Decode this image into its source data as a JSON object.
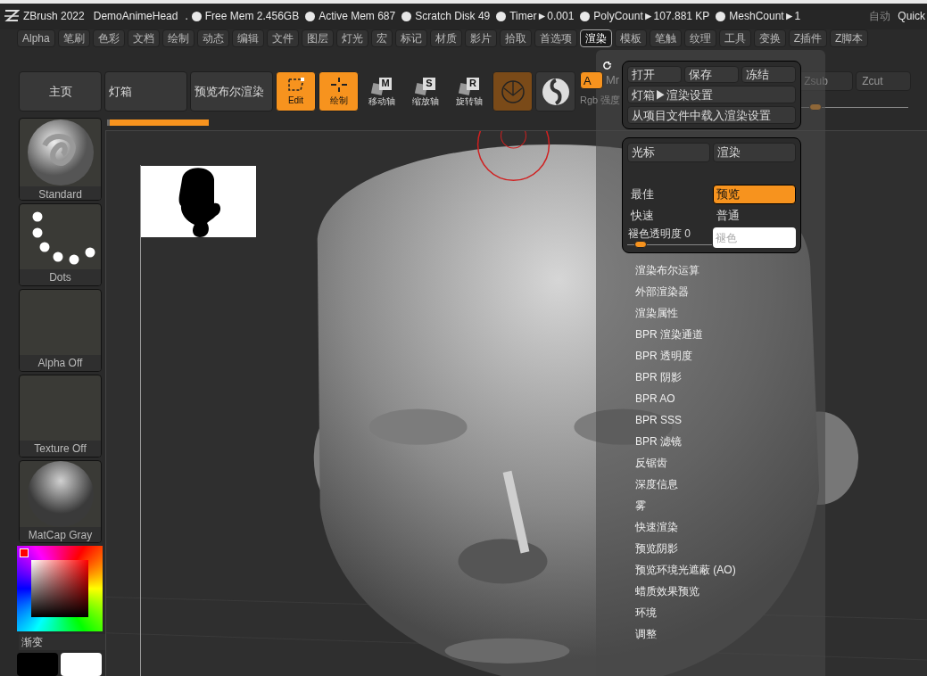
{
  "title_bar": {
    "app": "ZBrush 2022",
    "document": "DemoAnimeHead",
    "separator": ".",
    "stats": [
      "Free Mem 2.456GB",
      "Active Mem 687",
      "Scratch Disk 49",
      "Timer►0.001",
      "PolyCount►107.881 KP",
      "MeshCount►1"
    ],
    "right": [
      "自动",
      "Quick"
    ]
  },
  "menu": [
    {
      "label": "Alpha",
      "selected": false
    },
    {
      "label": "笔刷",
      "selected": false
    },
    {
      "label": "色彩",
      "selected": false
    },
    {
      "label": "文档",
      "selected": false
    },
    {
      "label": "绘制",
      "selected": false
    },
    {
      "label": "动态",
      "selected": false
    },
    {
      "label": "编辑",
      "selected": false
    },
    {
      "label": "文件",
      "selected": false
    },
    {
      "label": "图层",
      "selected": false
    },
    {
      "label": "灯光",
      "selected": false
    },
    {
      "label": "宏",
      "selected": false
    },
    {
      "label": "标记",
      "selected": false
    },
    {
      "label": "材质",
      "selected": false
    },
    {
      "label": "影片",
      "selected": false
    },
    {
      "label": "拾取",
      "selected": false
    },
    {
      "label": "首选项",
      "selected": false
    },
    {
      "label": "渲染",
      "selected": true
    },
    {
      "label": "模板",
      "selected": false
    },
    {
      "label": "笔触",
      "selected": false
    },
    {
      "label": "纹理",
      "selected": false
    },
    {
      "label": "工具",
      "selected": false
    },
    {
      "label": "变换",
      "selected": false
    },
    {
      "label": "Z插件",
      "selected": false
    },
    {
      "label": "Z脚本",
      "selected": false
    }
  ],
  "toolbar": [
    {
      "kind": "text",
      "label": "主页",
      "centered": true
    },
    {
      "kind": "text",
      "label": "灯箱",
      "centered": false
    },
    {
      "kind": "text",
      "label": "预览布尔渲染",
      "centered": false
    },
    {
      "kind": "tool",
      "label": "Edit",
      "active": true
    },
    {
      "kind": "tool",
      "label": "绘制",
      "active": true
    },
    {
      "kind": "axis",
      "letter": "M",
      "label": "移动轴"
    },
    {
      "kind": "axis",
      "letter": "S",
      "label": "缩放轴"
    },
    {
      "kind": "axis",
      "letter": "R",
      "label": "旋转轴"
    },
    {
      "kind": "material"
    },
    {
      "kind": "sphere"
    }
  ],
  "channel": {
    "label": "A",
    "active": true,
    "next": "Mr",
    "caption": "Rgb 强度"
  },
  "z_controls": [
    {
      "label": "Zsub",
      "active": false
    },
    {
      "label": "Zcut",
      "active": false
    }
  ],
  "z_slider": {
    "level": 0.12
  },
  "progress": {
    "level": 0.97
  },
  "left_tiles": [
    {
      "kind": "brush",
      "label": "Standard"
    },
    {
      "kind": "dots",
      "label": "Dots"
    },
    {
      "kind": "empty",
      "label": "Alpha Off"
    },
    {
      "kind": "empty",
      "label": "Texture Off"
    },
    {
      "kind": "matcap",
      "label": "MatCap Gray"
    }
  ],
  "color_picker": {
    "color": "#ff0000"
  },
  "gradient_label": "渐变",
  "swatches": [
    {
      "color": "#000000"
    },
    {
      "color": "#ffffff"
    }
  ],
  "render_palette": {
    "file_buttons": [
      "打开",
      "保存",
      "冻结"
    ],
    "wide_buttons": [
      "灯箱▶渲染设置",
      "从项目文件中载入渲染设置"
    ],
    "target_buttons": [
      "光标",
      "渲染"
    ],
    "modes": [
      {
        "label": "最佳",
        "selected": false
      },
      {
        "label": "预览",
        "selected": true
      },
      {
        "label": "快速",
        "selected": false
      },
      {
        "label": "普通",
        "selected": false
      }
    ],
    "fade": {
      "label": "褪色透明度",
      "value": "0",
      "level": 0.1
    },
    "fade_color": {
      "placeholder": "褪色"
    },
    "sections": [
      "渲染布尔运算",
      "外部渲染器",
      "渲染属性",
      "BPR 渲染通道",
      "BPR 透明度",
      "BPR 阴影",
      "BPR AO",
      "BPR SSS",
      "BPR 滤镜",
      "反锯齿",
      "深度信息",
      "雾",
      "快速渲染",
      "预览阴影",
      "预览环境光遮蔽 (AO)",
      "蜡质效果预览",
      "环境",
      "调整"
    ]
  }
}
